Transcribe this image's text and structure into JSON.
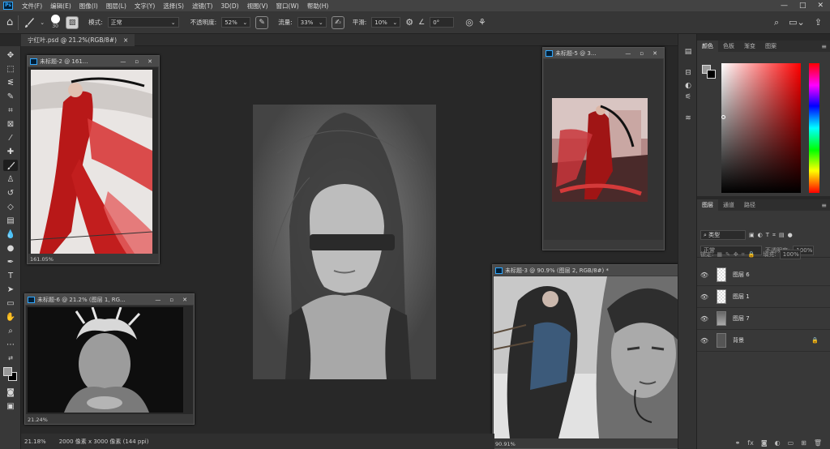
{
  "app": {
    "logo": "Ps",
    "menu": [
      "文件(F)",
      "编辑(E)",
      "图像(I)",
      "图层(L)",
      "文字(Y)",
      "选择(S)",
      "滤镜(T)",
      "3D(D)",
      "视图(V)",
      "窗口(W)",
      "帮助(H)"
    ],
    "window_controls": [
      "—",
      "□",
      "✕"
    ]
  },
  "options": {
    "brush_size": "30",
    "mode_label": "模式:",
    "mode_value": "正常",
    "opacity_label": "不透明度:",
    "opacity_value": "52%",
    "flow_label": "流量:",
    "flow_value": "33%",
    "smooth_label": "平滑:",
    "smooth_value": "10%",
    "angle_value": "0°"
  },
  "tab": {
    "title": "宁红叶.psd @ 21.2%(RGB/8#)",
    "close": "×"
  },
  "windows": [
    {
      "title": "未标题-2 @ 161...",
      "zoom": "161.05%"
    },
    {
      "title": "未标题-5 @ 3...",
      "zoom": ""
    },
    {
      "title": "未标题-6 @ 21.2% (图层 1, RG...",
      "zoom": "21.24%"
    },
    {
      "title": "未标题-3 @ 90.9% (图层 2, RGB/8#) *",
      "zoom": "90.91%"
    }
  ],
  "status": {
    "zoom": "21.18%",
    "doc_info": "2000 像素 x 3000 像素 (144 ppi)"
  },
  "color_panel": {
    "tabs": [
      "颜色",
      "色板",
      "渐变",
      "图案"
    ],
    "fg_color": "#9a9a9a",
    "bg_color": "#000000"
  },
  "layers_panel": {
    "tabs": [
      "图层",
      "通道",
      "路径"
    ],
    "filter_label": "类型",
    "blend_mode": "正常",
    "opacity_label": "不透明度:",
    "opacity_value": "100%",
    "lock_label": "锁定:",
    "fill_label": "填充:",
    "fill_value": "100%",
    "layers": [
      {
        "name": "图层 6",
        "thumb": "checker"
      },
      {
        "name": "图层 1",
        "thumb": "checker"
      },
      {
        "name": "图层 7",
        "thumb": "photo"
      },
      {
        "name": "背景",
        "thumb": "bg",
        "locked": true
      }
    ]
  }
}
